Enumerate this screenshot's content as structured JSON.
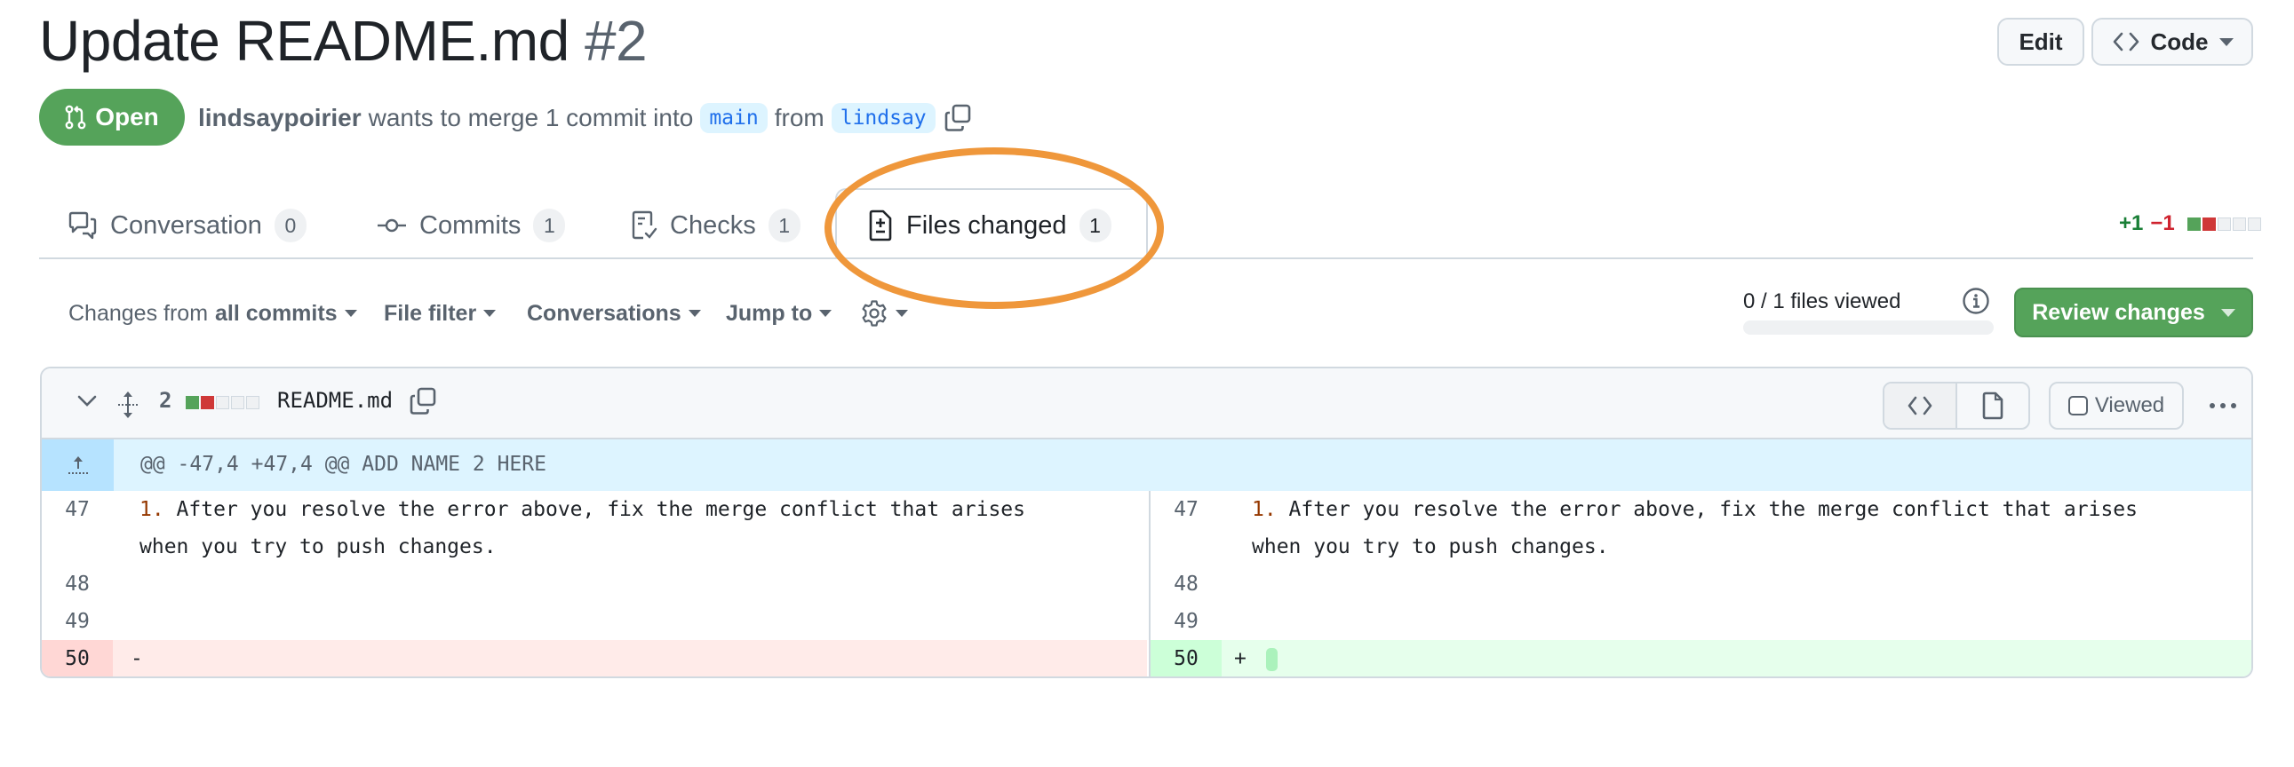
{
  "pr": {
    "title": "Update README.md",
    "number": "#2",
    "state": "Open",
    "author": "lindsaypoirier",
    "merge_text_1": "wants to merge 1 commit into",
    "base_branch": "main",
    "merge_text_2": "from",
    "head_branch": "lindsay"
  },
  "header_actions": {
    "edit_label": "Edit",
    "code_label": "Code"
  },
  "tabs": [
    {
      "label": "Conversation",
      "count": "0",
      "icon": "comment-discussion-icon",
      "active": false
    },
    {
      "label": "Commits",
      "count": "1",
      "icon": "git-commit-icon",
      "active": false
    },
    {
      "label": "Checks",
      "count": "1",
      "icon": "checklist-icon",
      "active": false
    },
    {
      "label": "Files changed",
      "count": "1",
      "icon": "file-diff-icon",
      "active": true
    }
  ],
  "diffstat": {
    "additions": "+1",
    "deletions": "−1",
    "blocks": [
      "added",
      "deleted",
      "neutral",
      "neutral",
      "neutral"
    ]
  },
  "toolbar": {
    "changes_from_prefix": "Changes from",
    "changes_from_value": "all commits",
    "file_filter": "File filter",
    "conversations": "Conversations",
    "jump_to": "Jump to",
    "files_viewed": "0 / 1 files viewed",
    "files_viewed_progress": 0,
    "review_changes": "Review changes"
  },
  "file": {
    "change_count": "2",
    "blocks": [
      "added",
      "deleted",
      "neutral",
      "neutral",
      "neutral"
    ],
    "name": "README.md",
    "viewed_label": "Viewed",
    "viewed_checked": false,
    "hunk_header": "@@ -47,4 +47,4 @@ ADD NAME 2 HERE",
    "left_lines": [
      {
        "num": "47",
        "marker": "1.",
        "text": " After you resolve the error above, fix the merge conflict that arises",
        "wrap": "when you try to push changes.",
        "type": "context"
      },
      {
        "num": "48",
        "text": "",
        "type": "context"
      },
      {
        "num": "49",
        "text": "",
        "type": "context"
      },
      {
        "num": "50",
        "sign": "-",
        "text": "",
        "type": "deletion"
      }
    ],
    "right_lines": [
      {
        "num": "47",
        "marker": "1.",
        "text": " After you resolve the error above, fix the merge conflict that arises",
        "wrap": "when you try to push changes.",
        "type": "context"
      },
      {
        "num": "48",
        "text": "",
        "type": "context"
      },
      {
        "num": "49",
        "text": "",
        "type": "context"
      },
      {
        "num": "50",
        "sign": "+",
        "text": "",
        "type": "addition"
      }
    ]
  },
  "colors": {
    "open_green": "#55a35a",
    "annotation_orange": "#ef973b",
    "addition": "#1a7f37",
    "deletion": "#cf222e"
  }
}
